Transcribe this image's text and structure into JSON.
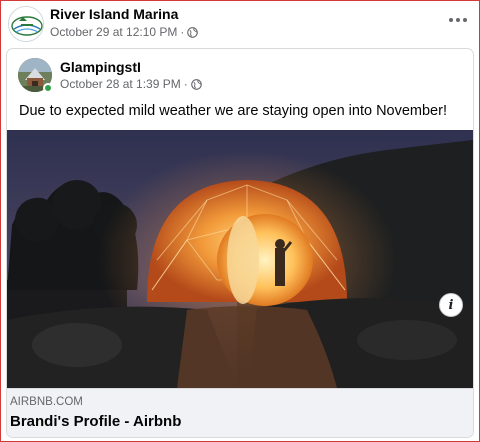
{
  "outer_post": {
    "page_name": "River Island Marina",
    "timestamp": "October 29 at 12:10 PM",
    "separator": "·",
    "privacy_icon": "globe-icon",
    "menu_icon": "more-horizontal-icon"
  },
  "shared_post": {
    "author_name": "GlampingstI",
    "timestamp": "October 28 at 1:39 PM",
    "separator": "·",
    "privacy_icon": "globe-icon",
    "online_status": "online",
    "text": "Due to expected mild weather we are staying open into November!"
  },
  "link_preview": {
    "domain": "AIRBNB.COM",
    "title": "Brandi's Profile - Airbnb",
    "info_icon": "info-icon",
    "info_label": "i"
  },
  "colors": {
    "frame_border": "#d23a3a",
    "secondary_text": "#65676b",
    "online_green": "#31a24c",
    "footer_bg": "#f0f2f5"
  }
}
